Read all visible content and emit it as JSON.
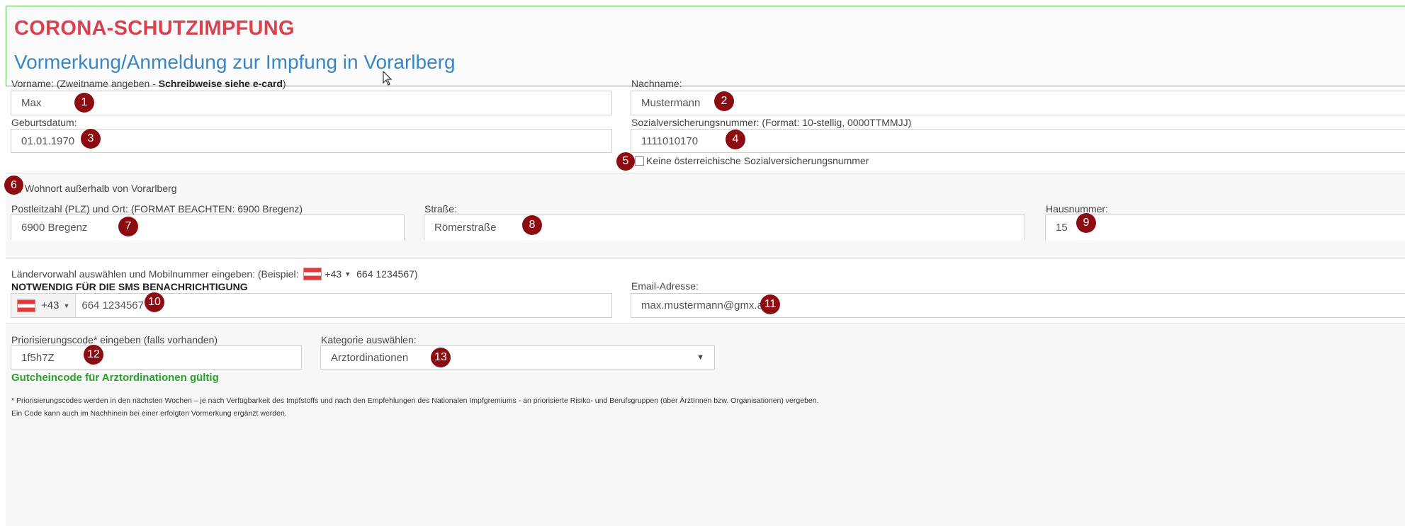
{
  "header": {
    "title": "CORONA-SCHUTZIMPFUNG",
    "subtitle": "Vormerkung/Anmeldung zur Impfung in Vorarlberg"
  },
  "person": {
    "firstname_label_prefix": "Vorname: (Zweitname angeben - ",
    "firstname_label_bold": "Schreibweise siehe e-card",
    "firstname_label_suffix": ")",
    "firstname_value": "Max",
    "lastname_label": "Nachname:",
    "lastname_value": "Mustermann",
    "birthdate_label": "Geburtsdatum:",
    "birthdate_value": "01.01.1970",
    "ssn_label": "Sozialversicherungsnummer: (Format: 10-stellig, 0000TTMMJJ)",
    "ssn_value": "1111010170",
    "no_ssn_label": "Keine österreichische Sozialversicherungsnummer"
  },
  "address": {
    "outside_label": "Wohnort außerhalb von Vorarlberg",
    "zip_label": "Postleitzahl (PLZ) und Ort: (FORMAT BEACHTEN: 6900 Bregenz)",
    "zip_value": "6900 Bregenz",
    "street_label": "Straße:",
    "street_value": "Römerstraße",
    "house_label": "Hausnummer:",
    "house_value": "15"
  },
  "contact": {
    "phone_hint_prefix": "Ländervorwahl auswählen und Mobilnummer eingeben: (Beispiel:",
    "phone_hint_code": "+43",
    "phone_hint_suffix": "664 1234567)",
    "phone_required": "NOTWENDIG FÜR DIE SMS BENACHRICHTIGUNG",
    "phone_code": "+43",
    "phone_value": "664 1234567",
    "email_label": "Email-Adresse:",
    "email_value": "max.mustermann@gmx.at"
  },
  "priority": {
    "code_label": "Priorisierungscode* eingeben (falls vorhanden)",
    "code_value": "1f5h7Z",
    "category_label": "Kategorie auswählen:",
    "category_value": "Arztordinationen",
    "valid_text": "Gutcheincode für Arztordinationen gültig"
  },
  "footnotes": [
    "* Priorisierungscodes werden in den nächsten Wochen – je nach Verfügbarkeit des Impfstoffs und nach den Empfehlungen des Nationalen Impfgremiums - an priorisierte Risiko- und Berufsgruppen (über ÄrztInnen bzw. Organisationen) vergeben.",
    "Ein Code kann auch im Nachhinein bei einer erfolgten Vormerkung ergänzt werden."
  ],
  "markers": [
    "1",
    "2",
    "3",
    "4",
    "5",
    "6",
    "7",
    "8",
    "9",
    "10",
    "11",
    "12",
    "13"
  ],
  "colors": {
    "title_red": "#d9414f",
    "subtitle_blue": "#3a86c1",
    "header_border_green": "#5cb85c",
    "valid_green": "#2ca02c",
    "marker_dark_red": "#8b0d12"
  }
}
